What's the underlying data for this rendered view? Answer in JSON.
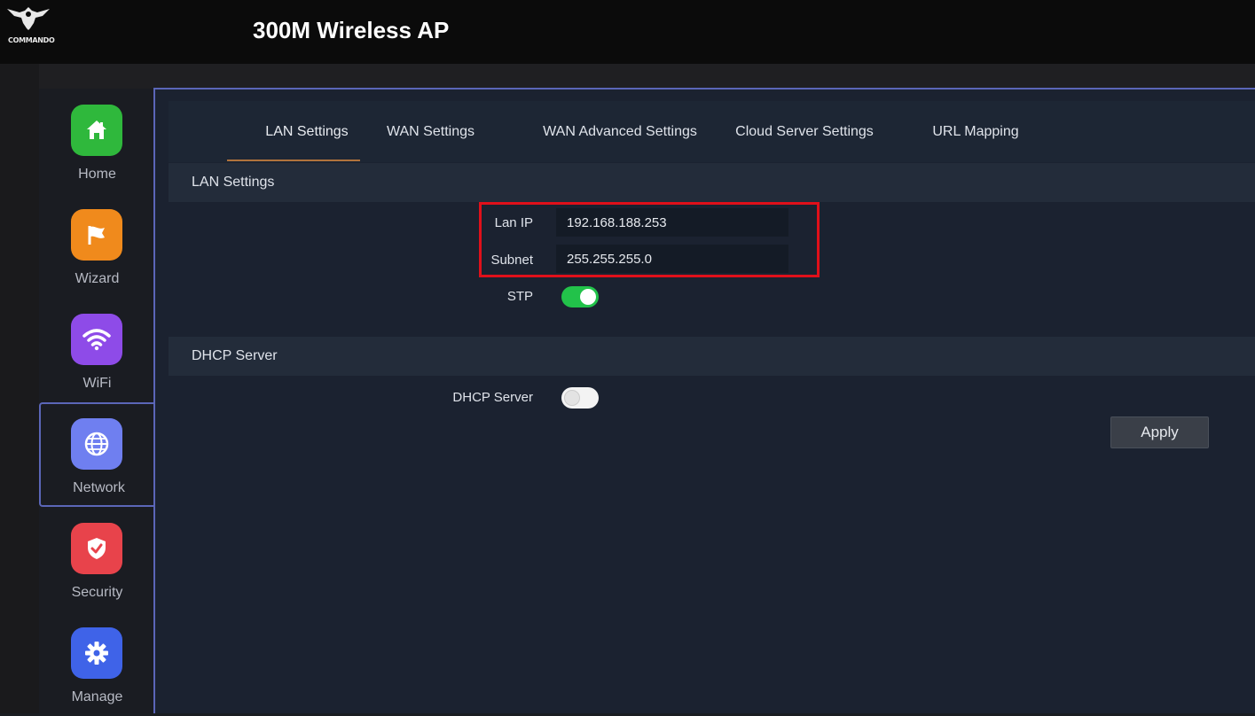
{
  "header": {
    "logo_text": "COMMANDO",
    "title": "300M Wireless AP"
  },
  "sidebar": {
    "items": [
      {
        "label": "Home",
        "icon": "home-icon",
        "color": "#2fb83c"
      },
      {
        "label": "Wizard",
        "icon": "flag-icon",
        "color": "#f08a1c"
      },
      {
        "label": "WiFi",
        "icon": "wifi-icon",
        "color": "#8e4be8"
      },
      {
        "label": "Network",
        "icon": "globe-icon",
        "color": "#6f7ff0",
        "active": true
      },
      {
        "label": "Security",
        "icon": "shield-check-icon",
        "color": "#e8434b"
      },
      {
        "label": "Manage",
        "icon": "gear-icon",
        "color": "#3f63e8"
      }
    ]
  },
  "tabs": [
    {
      "label": "LAN Settings",
      "active": true
    },
    {
      "label": "WAN Settings"
    },
    {
      "label": "WAN Advanced Settings"
    },
    {
      "label": "Cloud Server Settings"
    },
    {
      "label": "URL Mapping"
    }
  ],
  "lan": {
    "section_title": "LAN Settings",
    "ip_label": "Lan IP",
    "ip_value": "192.168.188.253",
    "subnet_label": "Subnet",
    "subnet_value": "255.255.255.0",
    "stp_label": "STP",
    "stp_enabled": true
  },
  "dhcp": {
    "section_title": "DHCP Server",
    "server_label": "DHCP Server",
    "server_enabled": false
  },
  "actions": {
    "apply_label": "Apply"
  },
  "colors": {
    "accent_border": "#5b66b8",
    "tab_underline": "#b0733c",
    "highlight_box": "#e0101a",
    "toggle_on": "#22c24a"
  }
}
